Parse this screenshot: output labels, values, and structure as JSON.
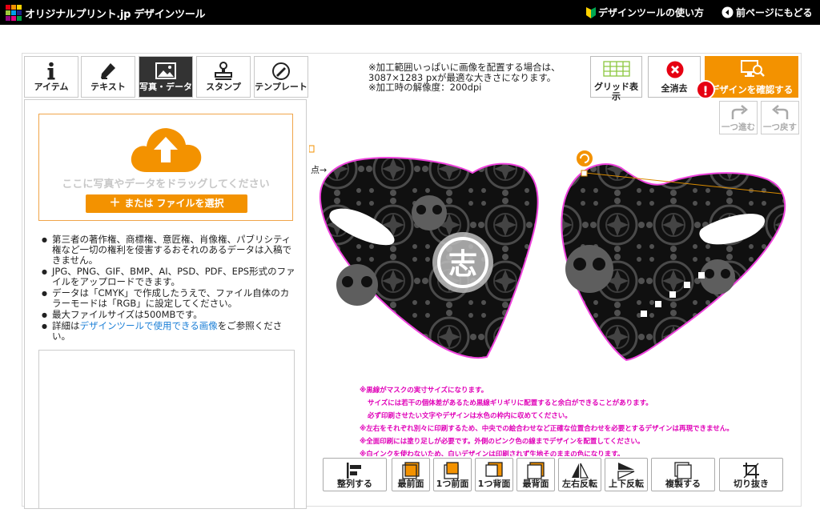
{
  "header": {
    "brand": "オリジナルプリント.jp デザインツール",
    "howto": "デザインツールの使い方",
    "back": "前ページにもどる"
  },
  "tabs": [
    {
      "label": "アイテム",
      "icon": "info-icon"
    },
    {
      "label": "テキスト",
      "icon": "pen-icon"
    },
    {
      "label": "写真・データ",
      "icon": "image-icon"
    },
    {
      "label": "スタンプ",
      "icon": "stamp-icon"
    },
    {
      "label": "テンプレート",
      "icon": "template-icon"
    }
  ],
  "upload": {
    "drop_text": "ここに写真やデータをドラッグしてください",
    "file_button": "または ファイルを選択"
  },
  "notes": {
    "n1": "第三者の著作権、商標権、意匠権、肖像権、パブリシティ権など一切の権利を侵害するおそれのあるデータは入稿できません。",
    "n2": "JPG、PNG、GIF、BMP、AI、PSD、PDF、EPS形式のファイルをアップロードできます。",
    "n3": "データは「CMYK」で作成したうえで、ファイル自体のカラーモードは「RGB」に設定してください。",
    "n4": "最大ファイルサイズは500MBです。",
    "n5_pre": "詳細は",
    "n5_link": "デザインツールで使用できる画像",
    "n5_post": "をご参照ください。"
  },
  "info": {
    "line1": "※加工範囲いっぱいに画像を配置する場合は、",
    "line2": "3087×1283 pxが最適な大きさになります。",
    "line3": "※加工時の解像度：200dpi"
  },
  "toolbar": {
    "grid": "グリッド表示",
    "clear": "全消去",
    "confirm": "デザインを確認する",
    "alert": "!",
    "redo": "一つ進む",
    "undo": "一つ戻す"
  },
  "canvas": {
    "center_fold_label": "点→",
    "logo_char": "志"
  },
  "warnings": {
    "w1": "※黒線がマスクの実寸サイズになります。",
    "w2": "サイズには若干の個体差があるため黒線ギリギリに配置すると余白ができることがあります。",
    "w3": "必ず印刷させたい文字やデザインは水色の枠内に収めてください。",
    "w4": "※左右をそれぞれ別々に印刷するため、中央での絵合わせなど正確な位置合わせを必要とするデザインは再現できません。",
    "w5": "※全面印刷には塗り足しが必要です。外側のピンク色の線までデザインを配置してください。",
    "w6": "※白インクを使わないため、白いデザインは印刷されず生地そのままの色になります。"
  },
  "bottom_tools": {
    "align": "整列する",
    "front": "最前面",
    "forward": "1つ前面",
    "backward": "1つ背面",
    "back": "最背面",
    "flip_h": "左右反転",
    "flip_v": "上下反転",
    "duplicate": "複製する",
    "crop": "切り抜き"
  },
  "colors": {
    "accent": "#f39200",
    "alert": "#e60012",
    "guide": "#e000b8"
  }
}
